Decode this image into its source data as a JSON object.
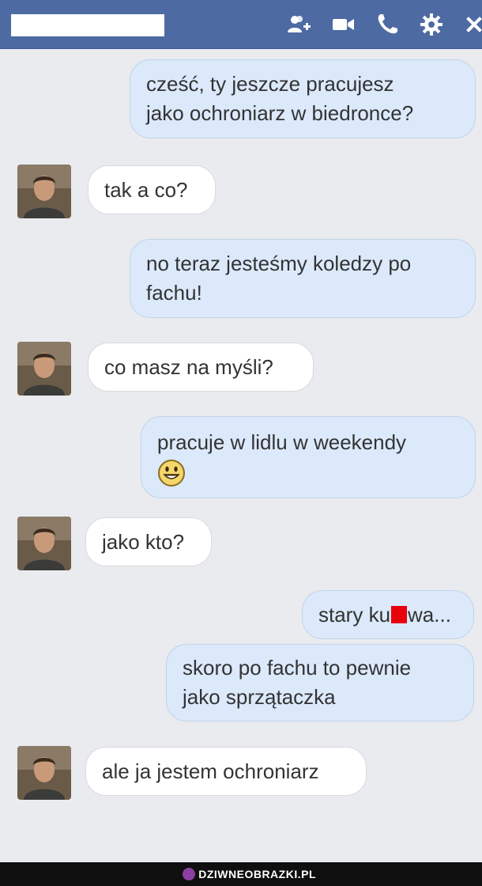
{
  "header": {
    "icons": [
      "add-friend-icon",
      "video-call-icon",
      "phone-icon",
      "gear-icon",
      "close-icon"
    ]
  },
  "messages": [
    {
      "from": "me",
      "lines": [
        "cześć, ty jeszcze pracujesz",
        "jako ochroniarz w biedronce?"
      ]
    },
    {
      "from": "them",
      "lines": [
        "tak a co?"
      ]
    },
    {
      "from": "me",
      "lines": [
        "no teraz jesteśmy koledzy po",
        "fachu!"
      ]
    },
    {
      "from": "them",
      "lines": [
        "co masz na myśli?"
      ]
    },
    {
      "from": "me",
      "lines": [
        "pracuje w lidlu w weekendy"
      ],
      "emoji": "smile-emoji"
    },
    {
      "from": "them",
      "lines": [
        "jako kto?"
      ]
    },
    {
      "from": "me",
      "parts": [
        "stary ku",
        "wa..."
      ],
      "censored": true
    },
    {
      "from": "me",
      "lines": [
        "skoro po fachu to pewnie",
        "jako sprzątaczka"
      ]
    },
    {
      "from": "them",
      "lines": [
        "ale ja jestem ochroniarz"
      ]
    }
  ],
  "watermark": "DZIWNEOBRAZKI.PL",
  "colors": {
    "header": "#4e6aa3",
    "my_bubble": "#dbe9fb",
    "their_bubble": "#ffffff",
    "background": "#e9ebee",
    "censor": "#e8000b"
  }
}
